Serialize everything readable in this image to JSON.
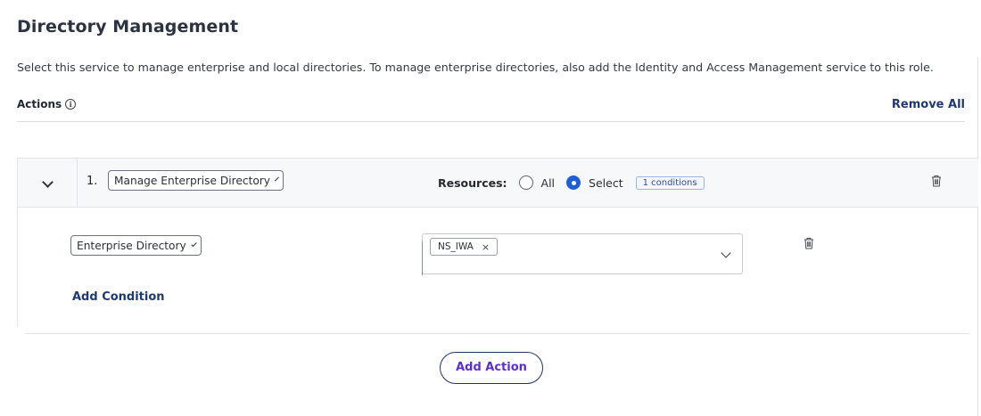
{
  "page": {
    "title": "Directory Management",
    "description": "Select this service to manage enterprise and local directories. To manage enterprise directories, also add the Identity and Access Management service to this role."
  },
  "actions": {
    "label": "Actions",
    "info_icon": "info-icon",
    "remove_all_label": "Remove All"
  },
  "action_rows": [
    {
      "number": "1.",
      "action_select": "Manage Enterprise Directory",
      "resources": {
        "label": "Resources:",
        "options": [
          "All",
          "Select"
        ],
        "selected": "Select",
        "conditions_badge": "1 conditions"
      },
      "conditions": [
        {
          "attribute_select": "Enterprise Directory",
          "values": [
            "NS_IWA"
          ]
        }
      ],
      "add_condition_label": "Add Condition"
    }
  ],
  "footer": {
    "add_action_label": "Add Action"
  },
  "colors": {
    "accent_blue": "#1f5fd6",
    "link_navy": "#213a6b",
    "add_action_text": "#5b2fc8"
  }
}
